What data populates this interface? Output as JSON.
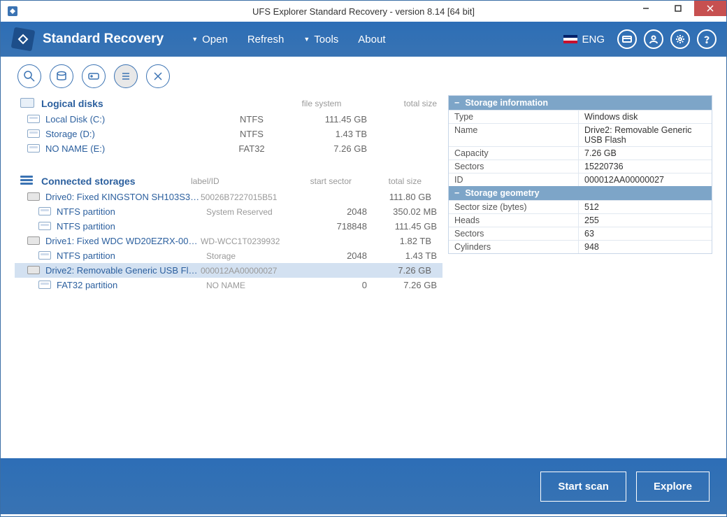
{
  "titlebar": {
    "title": "UFS Explorer Standard Recovery - version 8.14 [64 bit]"
  },
  "topnav": {
    "appname": "Standard Recovery",
    "menu": {
      "open": "Open",
      "refresh": "Refresh",
      "tools": "Tools",
      "about": "About"
    },
    "lang": "ENG"
  },
  "sections": {
    "logical": {
      "title": "Logical disks",
      "cols": {
        "fs": "file system",
        "ts": "total size"
      },
      "items": [
        {
          "name": "Local Disk (C:)",
          "fs": "NTFS",
          "size": "111.45 GB"
        },
        {
          "name": "Storage (D:)",
          "fs": "NTFS",
          "size": "1.43 TB"
        },
        {
          "name": "NO NAME (E:)",
          "fs": "FAT32",
          "size": "7.26 GB"
        }
      ]
    },
    "connected": {
      "title": "Connected storages",
      "cols": {
        "lid": "label/ID",
        "ss": "start sector",
        "ts": "total size"
      },
      "drives": [
        {
          "name": "Drive0: Fixed KINGSTON SH103S312...",
          "lid": "50026B7227015B51",
          "ss": "",
          "size": "111.80 GB",
          "parts": [
            {
              "name": "NTFS partition",
              "lid": "System Reserved",
              "ss": "2048",
              "size": "350.02 MB"
            },
            {
              "name": "NTFS partition",
              "lid": "",
              "ss": "718848",
              "size": "111.45 GB"
            }
          ]
        },
        {
          "name": "Drive1: Fixed WDC WD20EZRX-00DC...",
          "lid": "WD-WCC1T0239932",
          "ss": "",
          "size": "1.82 TB",
          "parts": [
            {
              "name": "NTFS partition",
              "lid": "Storage",
              "ss": "2048",
              "size": "1.43 TB"
            }
          ]
        },
        {
          "name": "Drive2: Removable Generic USB Flas ...",
          "lid": "000012AA00000027",
          "ss": "",
          "size": "7.26 GB",
          "selected": true,
          "parts": [
            {
              "name": "FAT32 partition",
              "lid": "NO NAME",
              "ss": "0",
              "size": "7.26 GB"
            }
          ]
        }
      ]
    }
  },
  "info": {
    "section1": {
      "title": "Storage information",
      "rows": [
        {
          "k": "Type",
          "v": "Windows disk"
        },
        {
          "k": "Name",
          "v": "Drive2: Removable Generic USB Flash"
        },
        {
          "k": "Capacity",
          "v": "7.26 GB"
        },
        {
          "k": "Sectors",
          "v": "15220736"
        },
        {
          "k": "ID",
          "v": "000012AA00000027"
        }
      ]
    },
    "section2": {
      "title": "Storage geometry",
      "rows": [
        {
          "k": "Sector size (bytes)",
          "v": "512"
        },
        {
          "k": "Heads",
          "v": "255"
        },
        {
          "k": "Sectors",
          "v": "63"
        },
        {
          "k": "Cylinders",
          "v": "948"
        }
      ]
    }
  },
  "bottom": {
    "scan": "Start scan",
    "explore": "Explore"
  }
}
